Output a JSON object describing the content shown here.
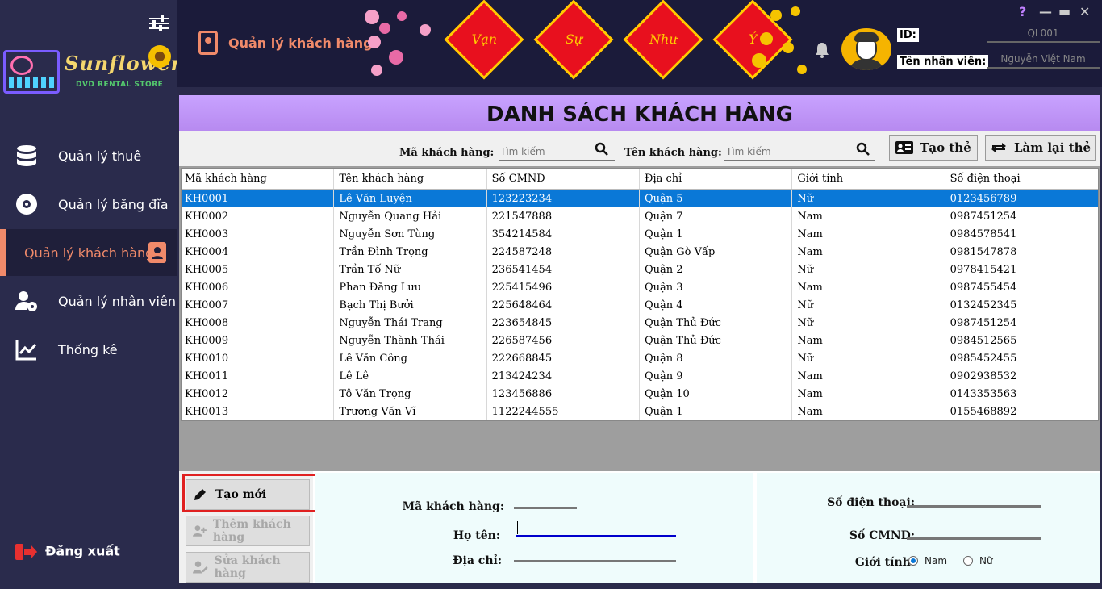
{
  "sidebar": {
    "items": [
      {
        "label": "Quản lý thuê",
        "icon": "database-icon"
      },
      {
        "label": "Quản lý băng đĩa",
        "icon": "disc-icon"
      },
      {
        "label": "Quản lý khách hàng",
        "icon": "contacts-icon",
        "active": true
      },
      {
        "label": "Quản lý nhân viên",
        "icon": "user-gear-icon"
      },
      {
        "label": "Thống kê",
        "icon": "chart-icon"
      }
    ],
    "logout_label": "Đăng xuất",
    "brand": "Sunflower",
    "brand_sub": "DVD RENTAL STORE"
  },
  "header": {
    "page_title": "Quản lý khách hàng",
    "greetings": [
      "Vạn",
      "Sự",
      "Như",
      "Ý"
    ],
    "id_label": "ID:",
    "id_value": "QL001",
    "staff_label": "Tên nhân viên:",
    "staff_value": "Nguyễn Việt Nam",
    "window_buttons": [
      "?",
      "—",
      "▬",
      "✕"
    ]
  },
  "main": {
    "title": "DANH SÁCH KHÁCH HÀNG",
    "search": {
      "code_label": "Mã khách hàng:",
      "code_placeholder": "Tìm kiếm",
      "name_label": "Tên khách hàng:",
      "name_placeholder": "Tìm kiếm",
      "create_card": "Tạo thẻ",
      "redo_card": "Làm lại thẻ"
    },
    "table": {
      "columns": [
        "Mã khách hàng",
        "Tên khách hàng",
        "Số CMND",
        "Địa chỉ",
        "Giới tính",
        "Số điện thoại"
      ],
      "rows": [
        [
          "KH0001",
          "Lê Văn Luyện",
          "123223234",
          "Quận 5",
          "Nữ",
          "0123456789"
        ],
        [
          "KH0002",
          "Nguyễn Quang Hải",
          "221547888",
          "Quận 7",
          "Nam",
          "0987451254"
        ],
        [
          "KH0003",
          "Nguyễn Sơn Tùng",
          "354214584",
          "Quận 1",
          "Nam",
          "0984578541"
        ],
        [
          "KH0004",
          "Trần Đình Trọng",
          "224587248",
          "Quận Gò Vấp",
          "Nam",
          "0981547878"
        ],
        [
          "KH0005",
          "Trần Tố Nữ",
          "236541454",
          "Quận 2",
          "Nữ",
          "0978415421"
        ],
        [
          "KH0006",
          "Phan Đăng Lưu",
          "225415496",
          "Quận 3",
          "Nam",
          "0987455454"
        ],
        [
          "KH0007",
          "Bạch Thị Bưởi",
          "225648464",
          "Quận 4",
          "Nữ",
          "0132452345"
        ],
        [
          "KH0008",
          "Nguyễn Thái Trang",
          "223654845",
          "Quận Thủ Đức",
          "Nữ",
          "0987451254"
        ],
        [
          "KH0009",
          "Nguyễn Thành Thái",
          "226587456",
          "Quận Thủ Đức",
          "Nam",
          "0984512565"
        ],
        [
          "KH0010",
          "Lê Văn Công",
          "222668845",
          "Quận 8",
          "Nữ",
          "0985452455"
        ],
        [
          "KH0011",
          "Lê Lê",
          "213424234",
          "Quận 9",
          "Nam",
          "0902938532"
        ],
        [
          "KH0012",
          "Tô Văn Trọng",
          "123456886",
          "Quận 10",
          "Nam",
          "0143353563"
        ],
        [
          "KH0013",
          "Trương Văn Vĩ",
          "1122244555",
          "Quận 1",
          "Nam",
          "0155468892"
        ]
      ]
    },
    "actions": {
      "new": "Tạo mới",
      "add": "Thêm khách hàng",
      "edit": "Sửa khách hàng"
    },
    "form": {
      "code_label": "Mã khách hàng:",
      "name_label": "Họ tên:",
      "address_label": "Địa chỉ:",
      "phone_label": "Số điện thoại:",
      "cmnd_label": "Số CMND:",
      "gender_label": "Giới tính:",
      "gender_options": [
        "Nam",
        "Nữ"
      ],
      "gender_selected": "Nam"
    }
  },
  "colors": {
    "accent": "#f08a6a",
    "selection": "#0a78d7",
    "banner": "#c8a2ff",
    "sidebar": "#2a2b4c"
  }
}
